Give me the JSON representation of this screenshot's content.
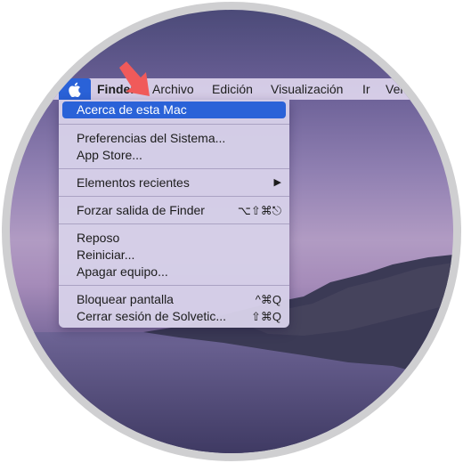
{
  "colors": {
    "highlight": "#2a62d8",
    "arrow": "#f05a5a",
    "menu_bg": "#d6d0e8"
  },
  "menubar": {
    "apple_icon": "apple-logo-icon",
    "items": [
      "Finder",
      "Archivo",
      "Edición",
      "Visualización",
      "Ir",
      "Ven"
    ]
  },
  "apple_menu": {
    "items": [
      {
        "label": "Acerca de esta Mac",
        "shortcut": "",
        "highlighted": true
      },
      {
        "label": "Preferencias del Sistema...",
        "shortcut": ""
      },
      {
        "label": "App Store...",
        "shortcut": ""
      },
      {
        "label": "Elementos recientes",
        "shortcut": "▶",
        "submenu": true
      },
      {
        "label": "Forzar salida de Finder",
        "shortcut": "⌥⇧⌘⎋"
      },
      {
        "label": "Reposo",
        "shortcut": ""
      },
      {
        "label": "Reiniciar...",
        "shortcut": ""
      },
      {
        "label": "Apagar equipo...",
        "shortcut": ""
      },
      {
        "label": "Bloquear pantalla",
        "shortcut": "^⌘Q"
      },
      {
        "label": "Cerrar sesión de Solvetic...",
        "shortcut": "⇧⌘Q"
      }
    ]
  },
  "annotation": {
    "arrow_icon": "pointer-arrow-icon"
  }
}
